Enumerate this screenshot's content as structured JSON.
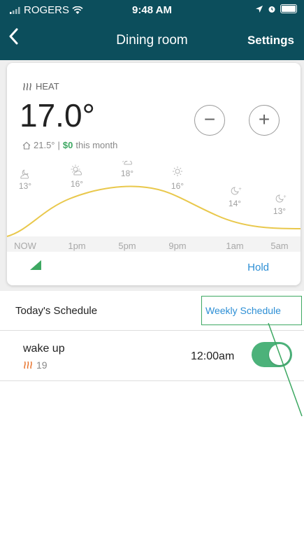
{
  "status_bar": {
    "carrier": "ROGERS",
    "time": "9:48 AM"
  },
  "nav": {
    "title": "Dining room",
    "settings_label": "Settings"
  },
  "thermostat": {
    "mode_label": "HEAT",
    "set_temperature": "17.0°",
    "indoor_temperature": "21.5°",
    "separator": "|",
    "cost": "$0",
    "cost_suffix": "this month",
    "decrease_label": "−",
    "increase_label": "+",
    "hold_label": "Hold"
  },
  "forecast": {
    "points": [
      {
        "time": "NOW",
        "temp": "13°",
        "icon": "partly-cloudy-night-icon"
      },
      {
        "time": "1pm",
        "temp": "16°",
        "icon": "partly-sunny-icon"
      },
      {
        "time": "5pm",
        "temp": "18°",
        "icon": "partly-sunny-icon"
      },
      {
        "time": "9pm",
        "temp": "16°",
        "icon": "sun-icon"
      },
      {
        "time": "1am",
        "temp": "14°",
        "icon": "clear-night-icon"
      },
      {
        "time": "5am",
        "temp": "13°",
        "icon": "clear-night-icon"
      }
    ],
    "line_color": "#e9c84c"
  },
  "schedule": {
    "today_label": "Today's Schedule",
    "weekly_label": "Weekly Schedule",
    "items": [
      {
        "name": "wake up",
        "setpoint": "19",
        "time": "12:00am",
        "enabled": true
      }
    ]
  },
  "colors": {
    "header": "#0c4e5c",
    "accent_blue": "#2d8fd5",
    "accent_green": "#3da862",
    "heat_orange": "#e8742d"
  }
}
